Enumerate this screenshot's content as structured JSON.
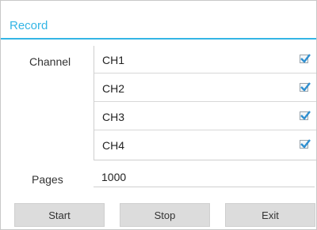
{
  "dialog": {
    "title": "Record"
  },
  "channel": {
    "label": "Channel",
    "items": [
      {
        "name": "CH1",
        "checked": true
      },
      {
        "name": "CH2",
        "checked": true
      },
      {
        "name": "CH3",
        "checked": true
      },
      {
        "name": "CH4",
        "checked": true
      }
    ]
  },
  "pages": {
    "label": "Pages",
    "value": "1000"
  },
  "buttons": {
    "start": "Start",
    "stop": "Stop",
    "exit": "Exit"
  },
  "colors": {
    "accent": "#33b5e5",
    "checkmark": "#2f8fd0",
    "button_bg": "#dcdcdc"
  },
  "icons": {
    "checkbox": "checkmark-icon"
  }
}
